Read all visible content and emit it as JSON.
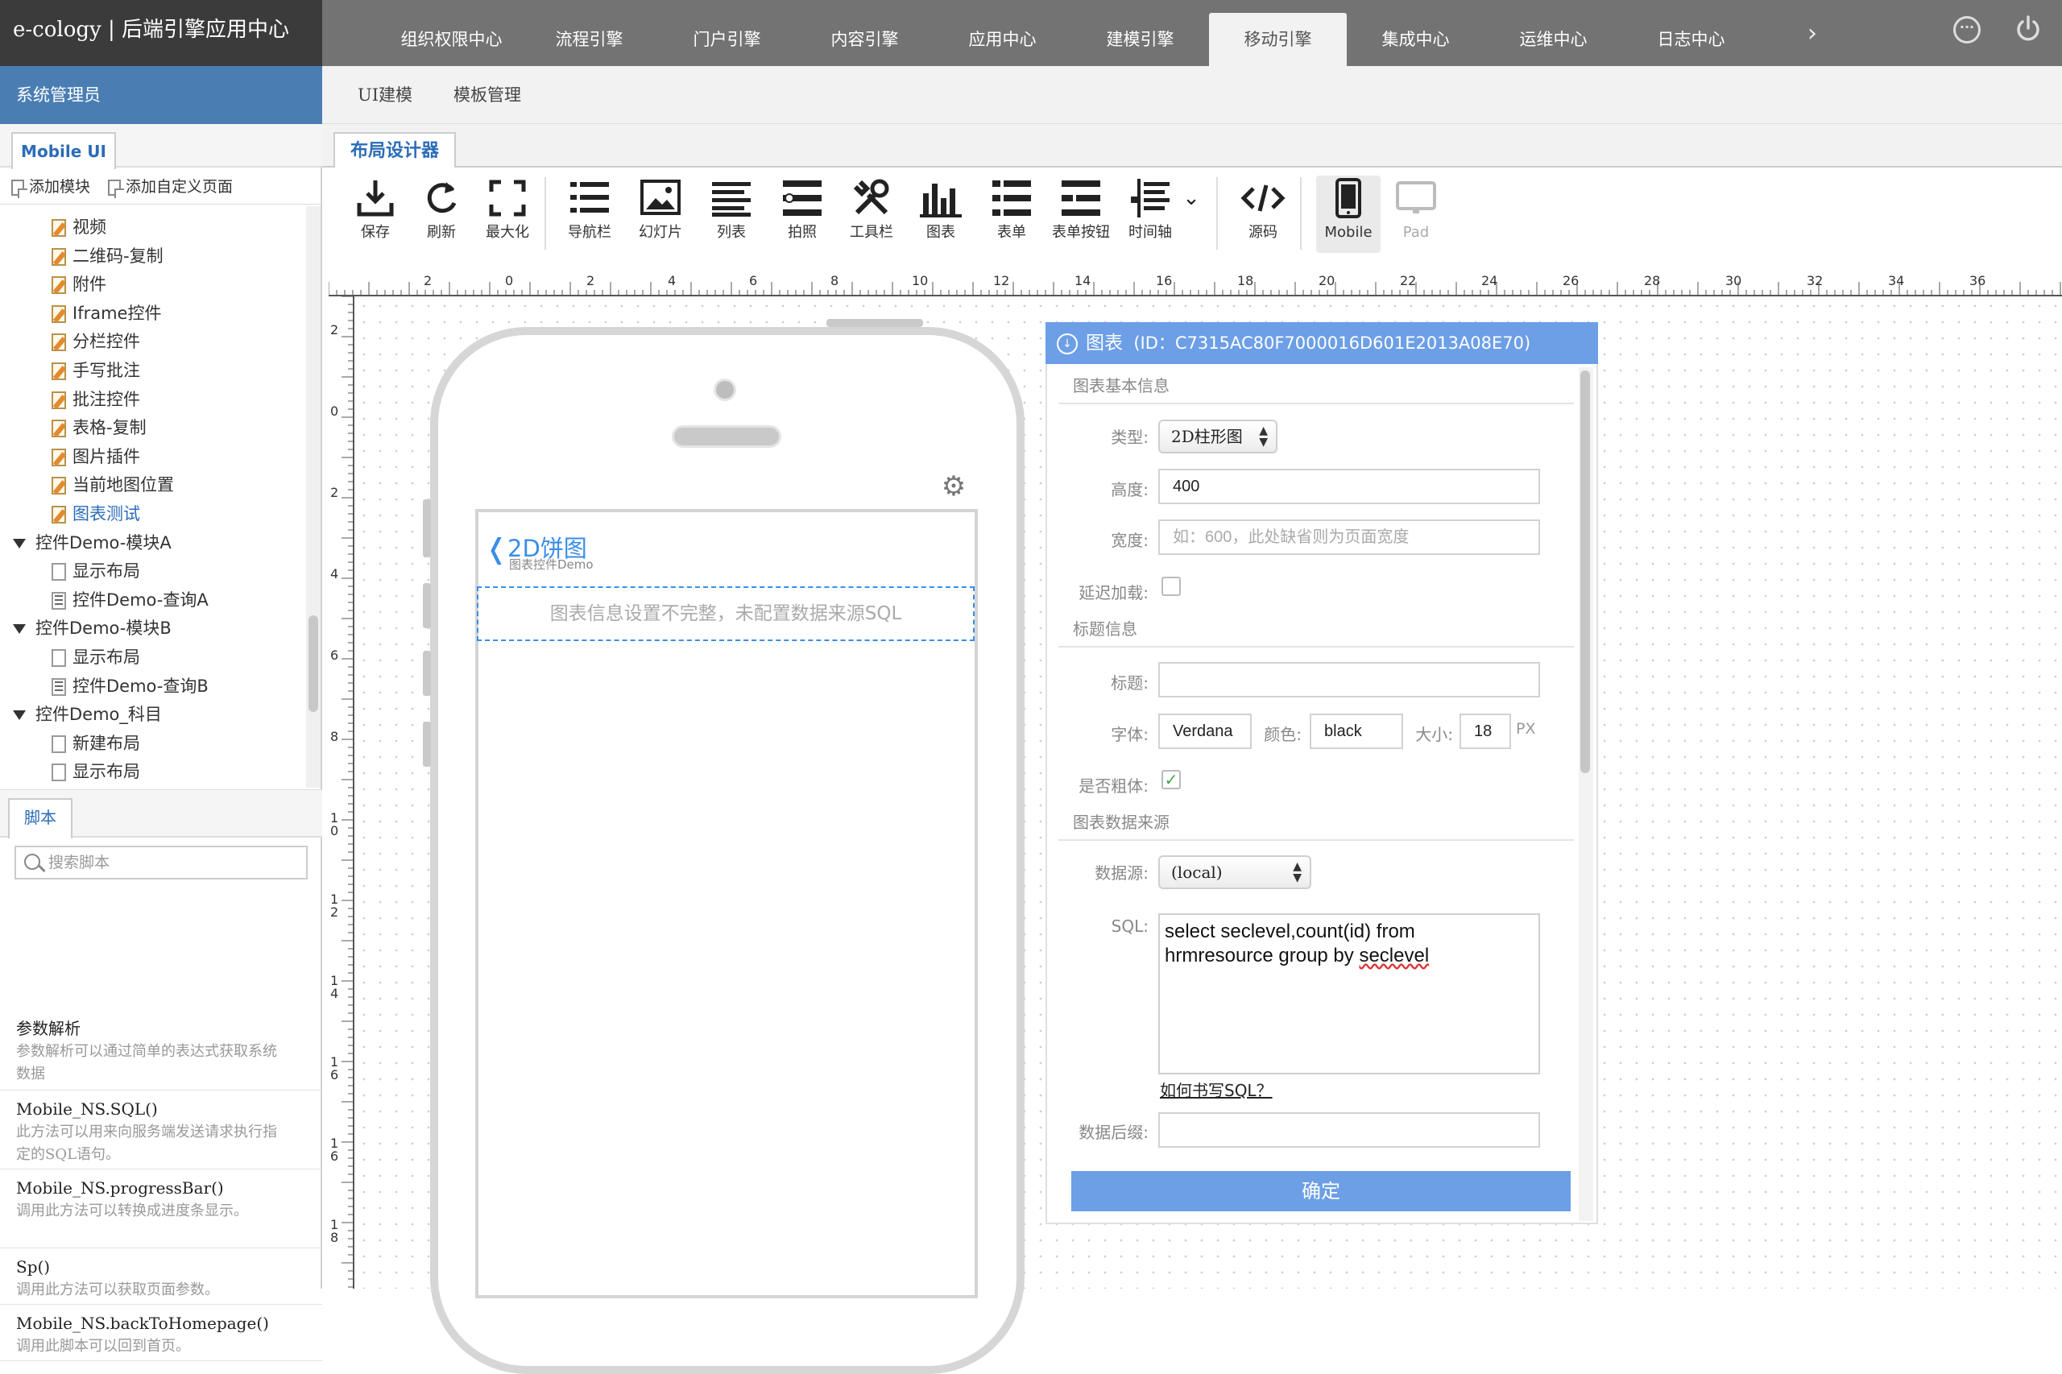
{
  "app": {
    "title": "e-cology | 后端引擎应用中心"
  },
  "topnav": {
    "tabs": [
      {
        "label": "组织权限中心"
      },
      {
        "label": "流程引擎"
      },
      {
        "label": "门户引擎"
      },
      {
        "label": "内容引擎"
      },
      {
        "label": "应用中心"
      },
      {
        "label": "建模引擎"
      },
      {
        "label": "移动引擎",
        "active": true
      },
      {
        "label": "集成中心"
      },
      {
        "label": "运维中心"
      },
      {
        "label": "日志中心"
      }
    ],
    "next_icon": "chevron-right-icon",
    "more_icon": "more-dots-icon",
    "power_icon": "power-icon"
  },
  "user": {
    "name": "系统管理员"
  },
  "subnav": {
    "items": [
      "UI建模",
      "模板管理"
    ]
  },
  "left": {
    "tab": "Mobile UI",
    "actions": {
      "add_module": "添加模块",
      "add_custom": "添加自定义页面"
    },
    "tree": [
      {
        "label": "视频",
        "icon": "edit-page-icon"
      },
      {
        "label": "二维码-复制",
        "icon": "edit-page-icon"
      },
      {
        "label": "附件",
        "icon": "edit-page-icon"
      },
      {
        "label": "Iframe控件",
        "icon": "edit-page-icon"
      },
      {
        "label": "分栏控件",
        "icon": "edit-page-icon"
      },
      {
        "label": "手写批注",
        "icon": "edit-page-icon"
      },
      {
        "label": "批注控件",
        "icon": "edit-page-icon"
      },
      {
        "label": "表格-复制",
        "icon": "edit-page-icon"
      },
      {
        "label": "图片插件",
        "icon": "edit-page-icon"
      },
      {
        "label": "当前地图位置",
        "icon": "edit-page-icon"
      },
      {
        "label": "图表测试",
        "icon": "edit-page-icon",
        "selected": true
      },
      {
        "label": "控件Demo-模块A",
        "icon": "expand-arrow-icon"
      },
      {
        "label": "显示布局",
        "icon": "page-icon"
      },
      {
        "label": "控件Demo-查询A",
        "icon": "list-page-icon"
      },
      {
        "label": "控件Demo-模块B",
        "icon": "expand-arrow-icon"
      },
      {
        "label": "显示布局",
        "icon": "page-icon"
      },
      {
        "label": "控件Demo-查询B",
        "icon": "list-page-icon"
      },
      {
        "label": "控件Demo_科目",
        "icon": "expand-arrow-icon"
      },
      {
        "label": "新建布局",
        "icon": "add-page-icon"
      },
      {
        "label": "显示布局",
        "icon": "page-icon"
      }
    ]
  },
  "scripts": {
    "tab": "脚本",
    "search_placeholder": "搜索脚本",
    "items": [
      {
        "title": "参数解析",
        "desc1": "参数解析可以通过简单的表达式获取系统",
        "desc2": "数据"
      },
      {
        "title": "Mobile_NS.SQL()",
        "desc1": "此方法可以用来向服务端发送请求执行指",
        "desc2": "定的SQL语句。"
      },
      {
        "title": "Mobile_NS.progressBar()",
        "desc1": "调用此方法可以转换成进度条显示。",
        "desc2": ""
      },
      {
        "title": "Sp()",
        "desc1": "调用此方法可以获取页面参数。",
        "desc2": ""
      },
      {
        "title": "Mobile_NS.backToHomepage()",
        "desc1": "调用此脚本可以回到首页。",
        "desc2": ""
      }
    ]
  },
  "designer": {
    "tab": "布局设计器",
    "tools": [
      {
        "label": "保存",
        "icon": "save-icon"
      },
      {
        "label": "刷新",
        "icon": "refresh-icon"
      },
      {
        "label": "最大化",
        "icon": "maximize-icon"
      },
      {
        "label": "导航栏",
        "icon": "navbar-icon"
      },
      {
        "label": "幻灯片",
        "icon": "slideshow-icon"
      },
      {
        "label": "列表",
        "icon": "list-icon"
      },
      {
        "label": "拍照",
        "icon": "camera-icon"
      },
      {
        "label": "工具栏",
        "icon": "tools-icon"
      },
      {
        "label": "图表",
        "icon": "chart-icon"
      },
      {
        "label": "表单",
        "icon": "form-icon"
      },
      {
        "label": "表单按钮",
        "icon": "form-button-icon"
      },
      {
        "label": "时间轴",
        "icon": "timeline-icon"
      },
      {
        "label": "源码",
        "icon": "code-icon"
      },
      {
        "label": "Mobile",
        "icon": "mobile-icon",
        "selected": true
      },
      {
        "label": "Pad",
        "icon": "pad-icon",
        "disabled": true
      }
    ]
  },
  "ruler": {
    "top": [
      "2",
      "0",
      "2",
      "4",
      "6",
      "8",
      "10",
      "12",
      "14",
      "16",
      "18",
      "20",
      "22",
      "24",
      "26",
      "28",
      "30",
      "32",
      "34",
      "36"
    ],
    "left": [
      "2",
      "0",
      "2",
      "4",
      "6",
      "8",
      "10",
      "12",
      "14",
      "16",
      "16",
      "18"
    ]
  },
  "phone": {
    "title": "2D饼图",
    "subtitle": "图表控件Demo",
    "message": "图表信息设置不完整，未配置数据来源SQL"
  },
  "panel": {
    "title": "图表",
    "id_text": "(ID：C7315AC80F7000016D601E2013A08E70)",
    "sections": {
      "basic": "图表基本信息",
      "title_info": "标题信息",
      "source": "图表数据来源"
    },
    "labels": {
      "type": "类型:",
      "height": "高度:",
      "width": "宽度:",
      "lazy": "延迟加载:",
      "title": "标题:",
      "font": "字体:",
      "color": "颜色:",
      "size": "大小:",
      "bold": "是否粗体:",
      "datasource": "数据源:",
      "sql": "SQL:",
      "suffix": "数据后缀:"
    },
    "values": {
      "type": "2D柱形图",
      "height": "400",
      "width_placeholder": "如：600，此处缺省则为页面宽度",
      "lazy_checked": false,
      "title": "",
      "font": "Verdana",
      "color": "black",
      "size": "18",
      "size_unit": "PX",
      "bold_checked": true,
      "datasource": "(local)",
      "sql_line1": "select seclevel,count(id) from",
      "sql_line2a": "hrmresource group by ",
      "sql_line2b": "seclevel",
      "suffix": ""
    },
    "sql_help": "如何书写SQL？",
    "confirm": "确定"
  }
}
